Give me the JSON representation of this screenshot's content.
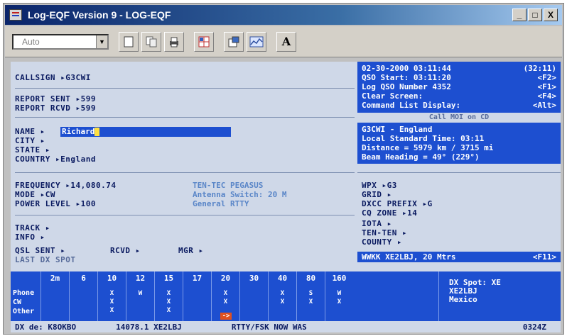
{
  "window": {
    "title": "Log-EQF Version 9 - LOG-EQF",
    "min_label": "_",
    "max_label": "□",
    "close_label": "X"
  },
  "toolbar": {
    "mode_value": "Auto",
    "format_label": "A"
  },
  "station": {
    "callsign_label": "CALLSIGN ▸G3CWI",
    "report_sent_label": "REPORT SENT ▸599",
    "report_rcvd_label": "REPORT RCVD ▸599",
    "name_label": "NAME ▸",
    "name_value": "Richard",
    "city_label": "CITY ▸",
    "state_label": "STATE ▸",
    "country_label": "COUNTRY ▸England",
    "frequency_label": "FREQUENCY ▸14,080.74",
    "mode_label": "MODE ▸CW",
    "power_label": "POWER LEVEL ▸100",
    "track_label": "TRACK ▸",
    "info_label": "INFO ▸",
    "qsl_sent_label": "QSL SENT ▸",
    "rcvd_label": "RCVD ▸",
    "mgr_label": "MGR ▸",
    "last_dx_label": "LAST DX SPOT"
  },
  "radio": {
    "line1": "TEN-TEC PEGASUS",
    "line2": "Antenna Switch: 20 M",
    "line3": "General RTTY"
  },
  "info_panel": {
    "rows": [
      {
        "left": "02-30-2000 03:11:44",
        "right": "(32:11)"
      },
      {
        "left": "QSO Start: 03:11:20",
        "right": "<F2>"
      },
      {
        "left": "Log QSO Number 4352",
        "right": "<F1>"
      },
      {
        "left": "Clear Screen:",
        "right": "<F4>"
      },
      {
        "left": "Command List Display:",
        "right": "<Alt>"
      }
    ]
  },
  "call_sep": "Call MOI on CD",
  "location_panel": {
    "rows": [
      "G3CWI - England",
      "Local Standard Time: 03:11",
      "Distance = 5979 km / 3715 mi",
      "Beam Heading = 49° (229°)"
    ]
  },
  "awards": {
    "wpx_label": "WPX ▸G3",
    "grid_label": "GRID ▸",
    "dxcc_label": "DXCC PREFIX ▸G",
    "cq_zone_label": "CQ ZONE ▸14",
    "iota_label": "IOTA ▸",
    "ten_ten_label": "TEN-TEN ▸",
    "county_label": "COUNTY ▸"
  },
  "last_spot": {
    "text": "WWKK XE2LBJ, 20 Mtrs",
    "key": "<F11>"
  },
  "bands": {
    "headers": [
      "2m",
      "6",
      "10",
      "12",
      "15",
      "17",
      "20",
      "30",
      "40",
      "80",
      "160"
    ],
    "modes": [
      "Phone",
      "CW",
      "Other"
    ],
    "marks": [
      [
        "",
        "",
        ""
      ],
      [
        "",
        "",
        ""
      ],
      [
        "X",
        "X",
        "X"
      ],
      [
        "W",
        "",
        ""
      ],
      [
        "X",
        "X",
        "X"
      ],
      [
        "",
        "",
        ""
      ],
      [
        "X",
        "X",
        ""
      ],
      [
        "",
        "",
        ""
      ],
      [
        "X",
        "X",
        ""
      ],
      [
        "S",
        "X",
        ""
      ],
      [
        "W",
        "X",
        ""
      ]
    ],
    "new_spot_marker": "->"
  },
  "dx_spot": {
    "line1": "DX Spot: XE",
    "line2": "XE2LBJ",
    "line3": "Mexico"
  },
  "status": {
    "dx_de": "DX de: K8OKBO",
    "frequency": "14078.1 XE2LBJ",
    "comment": "RTTY/FSK NOW WAS",
    "time": "0324Z"
  },
  "colors": {
    "panel_blue": "#1d4fd0",
    "console_bg": "#cfd8e8",
    "label_navy": "#0a1a60"
  }
}
